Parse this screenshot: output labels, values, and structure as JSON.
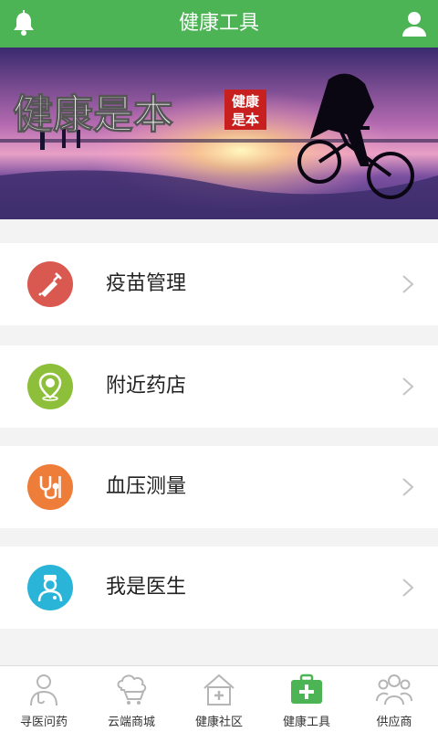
{
  "header": {
    "title": "健康工具",
    "left_icon": "bell-icon",
    "right_icon": "user-icon",
    "bar_color": "#4cb454"
  },
  "banner": {
    "headline": "健康是本",
    "stamp_line1": "健康",
    "stamp_line2": "是本"
  },
  "tools": [
    {
      "label": "疫苗管理",
      "icon": "syringe-icon",
      "color": "#d9584f"
    },
    {
      "label": "附近药店",
      "icon": "map-pin-icon",
      "color": "#8ebf3a"
    },
    {
      "label": "血压测量",
      "icon": "stethoscope-icon",
      "color": "#ef7d3a"
    },
    {
      "label": "我是医生",
      "icon": "doctor-icon",
      "color": "#29b4d8"
    }
  ],
  "bottom_nav": [
    {
      "label": "寻医问药",
      "icon": "doctor-avatar-icon",
      "active": false
    },
    {
      "label": "云端商城",
      "icon": "cloud-cart-icon",
      "active": false
    },
    {
      "label": "健康社区",
      "icon": "house-cross-icon",
      "active": false
    },
    {
      "label": "健康工具",
      "icon": "medical-kit-icon",
      "active": true
    },
    {
      "label": "供应商",
      "icon": "group-icon",
      "active": false
    }
  ],
  "colors": {
    "accent": "#4cb454",
    "inactive_icon": "#b5b5b5"
  }
}
